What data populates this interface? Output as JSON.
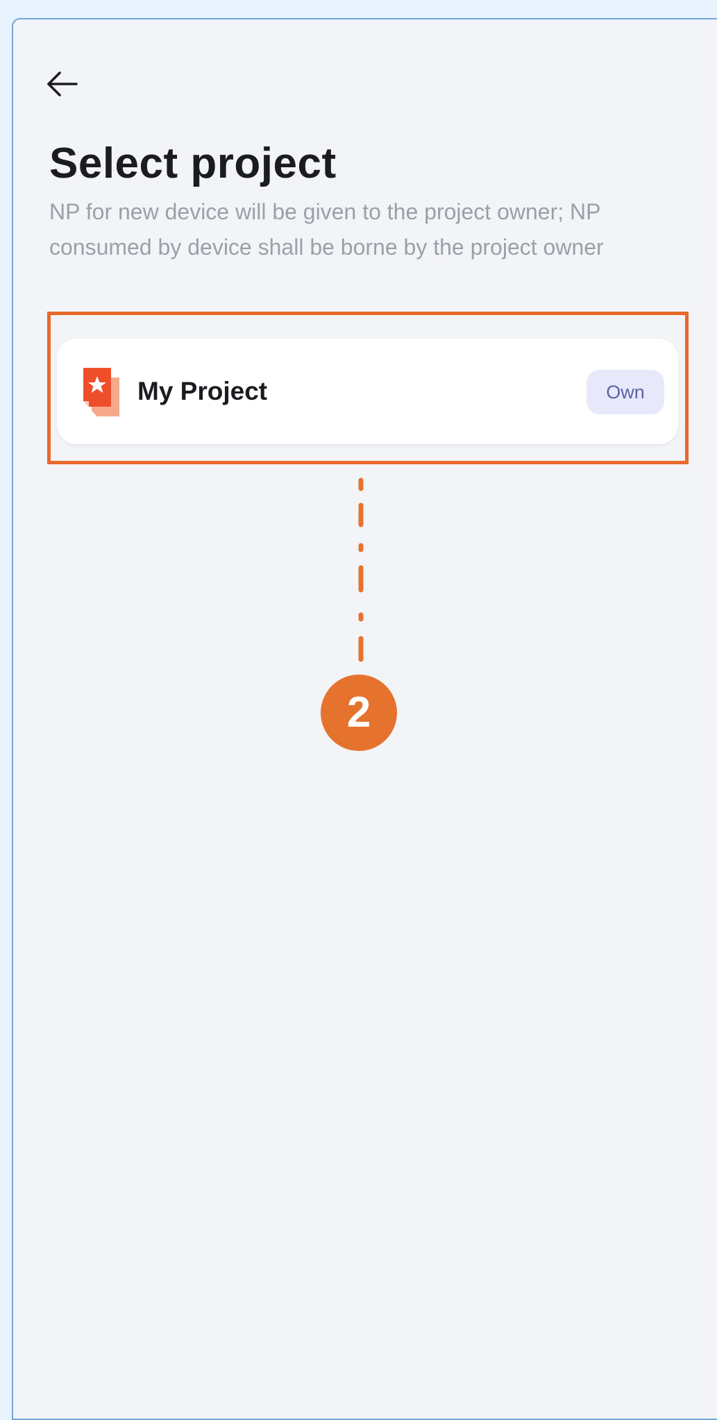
{
  "header": {
    "back_icon": "arrow-left-icon",
    "title": "Select project",
    "subtitle": "NP for new device will be given to the project owner; NP consumed by device shall be borne by the project owner"
  },
  "projects": [
    {
      "name": "My Project",
      "badge": "Own",
      "icon": "project-star-icon"
    }
  ],
  "annotation": {
    "step_number": "2",
    "highlight_color": "#e8692b"
  },
  "colors": {
    "accent": "#e5732d",
    "badge_bg": "#e7e9fb",
    "badge_text": "#5b64a8"
  }
}
